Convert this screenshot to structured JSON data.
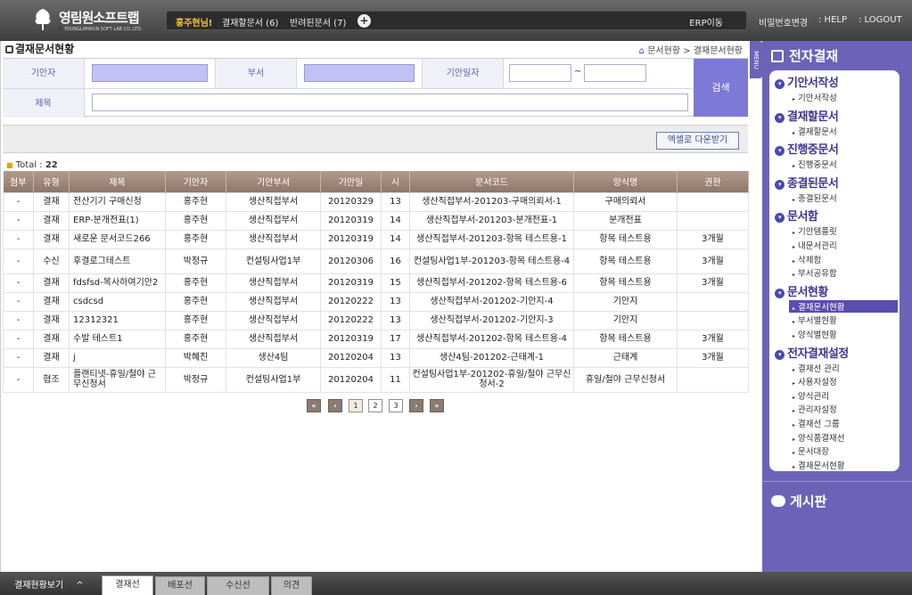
{
  "header": {
    "logo_name": "영림원소프트랩",
    "logo_sub": "YOUNGLIMWON SOFT LAB CO.,LTD.",
    "user_greeting": "홍주현님!",
    "pending_docs": "결재할문서 (6)",
    "returned_docs": "반려된문서 (7)",
    "plus_icon": "+",
    "erp_link": "ERP이동",
    "nav": [
      "비밀번호변경",
      ": HELP",
      ": LOGOUT"
    ]
  },
  "page": {
    "title": "결재문서현황",
    "breadcrumb": [
      "문서현황",
      "결재문서현황"
    ],
    "breadcrumb_sep": ">"
  },
  "search": {
    "drafter_label": "기안자",
    "dept_label": "부서",
    "date_label": "기안일자",
    "date_sep": "~",
    "title_label": "제목",
    "search_button": "검색",
    "drafter_value": "",
    "dept_value": "",
    "date_from": "",
    "date_to": "",
    "title_value": ""
  },
  "toolbar": {
    "excel_button": "엑셀로 다운받기"
  },
  "total": {
    "label": "Total : ",
    "count": "22"
  },
  "table": {
    "headers": [
      "첨부",
      "유형",
      "제목",
      "기안자",
      "기안부서",
      "기안일",
      "시",
      "문서코드",
      "양식명",
      "권한"
    ],
    "rows": [
      [
        "-",
        "결재",
        "전산기기 구매신청",
        "홍주현",
        "생산직접부서",
        "20120329",
        "13",
        "생산직접부서-201203-구매의뢰서-1",
        "구매의뢰서",
        ""
      ],
      [
        "-",
        "결재",
        "ERP-분개전표(1)",
        "홍주현",
        "생산직접부서",
        "20120319",
        "14",
        "생산직접부서-201203-분개전표-1",
        "분개전표",
        ""
      ],
      [
        "-",
        "결재",
        "새로운 문서코드266",
        "홍주현",
        "생산직접부서",
        "20120319",
        "14",
        "생산직접부서-201203-항목 테스트용-1",
        "항목 테스트용",
        "3개월"
      ],
      [
        "-",
        "수신",
        "후결로그테스트",
        "박정규",
        "컨설팅사업1부",
        "20120306",
        "16",
        "컨설팅사업1부-201203-항목 테스트용-4",
        "항목 테스트용",
        "3개월"
      ],
      [
        "-",
        "결재",
        "fdsfsd-복사하여기안2",
        "홍주현",
        "생산직접부서",
        "20120319",
        "15",
        "생산직접부서-201202-항목 테스트용-6",
        "항목 테스트용",
        "3개월"
      ],
      [
        "-",
        "결재",
        "csdcsd",
        "홍주현",
        "생산직접부서",
        "20120222",
        "13",
        "생산직접부서-201202-기안지-4",
        "기안지",
        ""
      ],
      [
        "-",
        "결재",
        "12312321",
        "홍주현",
        "생산직접부서",
        "20120222",
        "13",
        "생산직접부서-201202-기안지-3",
        "기안지",
        ""
      ],
      [
        "-",
        "결재",
        "수발 테스트1",
        "홍주현",
        "생산직접부서",
        "20120319",
        "17",
        "생산직접부서-201202-항목 테스트용-4",
        "항목 테스트용",
        "3개월"
      ],
      [
        "-",
        "결재",
        "j",
        "박혜진",
        "생산4팀",
        "20120204",
        "13",
        "생산4팀-201202-근태계-1",
        "근태계",
        "3개월"
      ],
      [
        "-",
        "협조",
        "플랜티넷-휴일/철야 근무신청서",
        "박정규",
        "컨설팅사업1부",
        "20120204",
        "11",
        "컨설팅사업1부-201202-휴일/철야 근무신청서-2",
        "휴일/철야 근무신청서",
        ""
      ]
    ]
  },
  "pager": {
    "first": "«",
    "prev": "‹",
    "pages": [
      "1",
      "2",
      "3"
    ],
    "current": "1",
    "next": "›",
    "last": "»"
  },
  "sidebar": {
    "menu_tab": "MENU",
    "title": "전자결재",
    "sections": [
      {
        "label": "기안서작성",
        "items": [
          "기안서작성"
        ]
      },
      {
        "label": "결재할문서",
        "items": [
          "결재할문서"
        ]
      },
      {
        "label": "진행중문서",
        "items": [
          "진행중문서"
        ]
      },
      {
        "label": "종결된문서",
        "items": [
          "종결된문서"
        ]
      },
      {
        "label": "문서함",
        "items": [
          "기안템플릿",
          "내문서관리",
          "삭제함",
          "부서공유함"
        ]
      },
      {
        "label": "문서현황",
        "items": [
          "결재문서현황",
          "부서별현황",
          "양식별현황"
        ]
      },
      {
        "label": "전자결재설정",
        "items": [
          "결재선 관리",
          "사용자설정",
          "양식관리",
          "관리자설정",
          "결재선 그룹",
          "양식품결재선",
          "문서대장",
          "결재문서현황"
        ]
      }
    ],
    "active_item": "결재문서현황",
    "board": "게시판"
  },
  "bottom": {
    "title": "결재현황보기",
    "chevron": "^",
    "tabs": [
      "결재선",
      "배포선",
      "수신선",
      "의견"
    ],
    "active_tab": "결재선"
  },
  "colors": {
    "accent": "#6c63b8",
    "header_bg": "#4a4a4a",
    "table_head": "#9d8477",
    "user_highlight": "#f3c23c"
  }
}
